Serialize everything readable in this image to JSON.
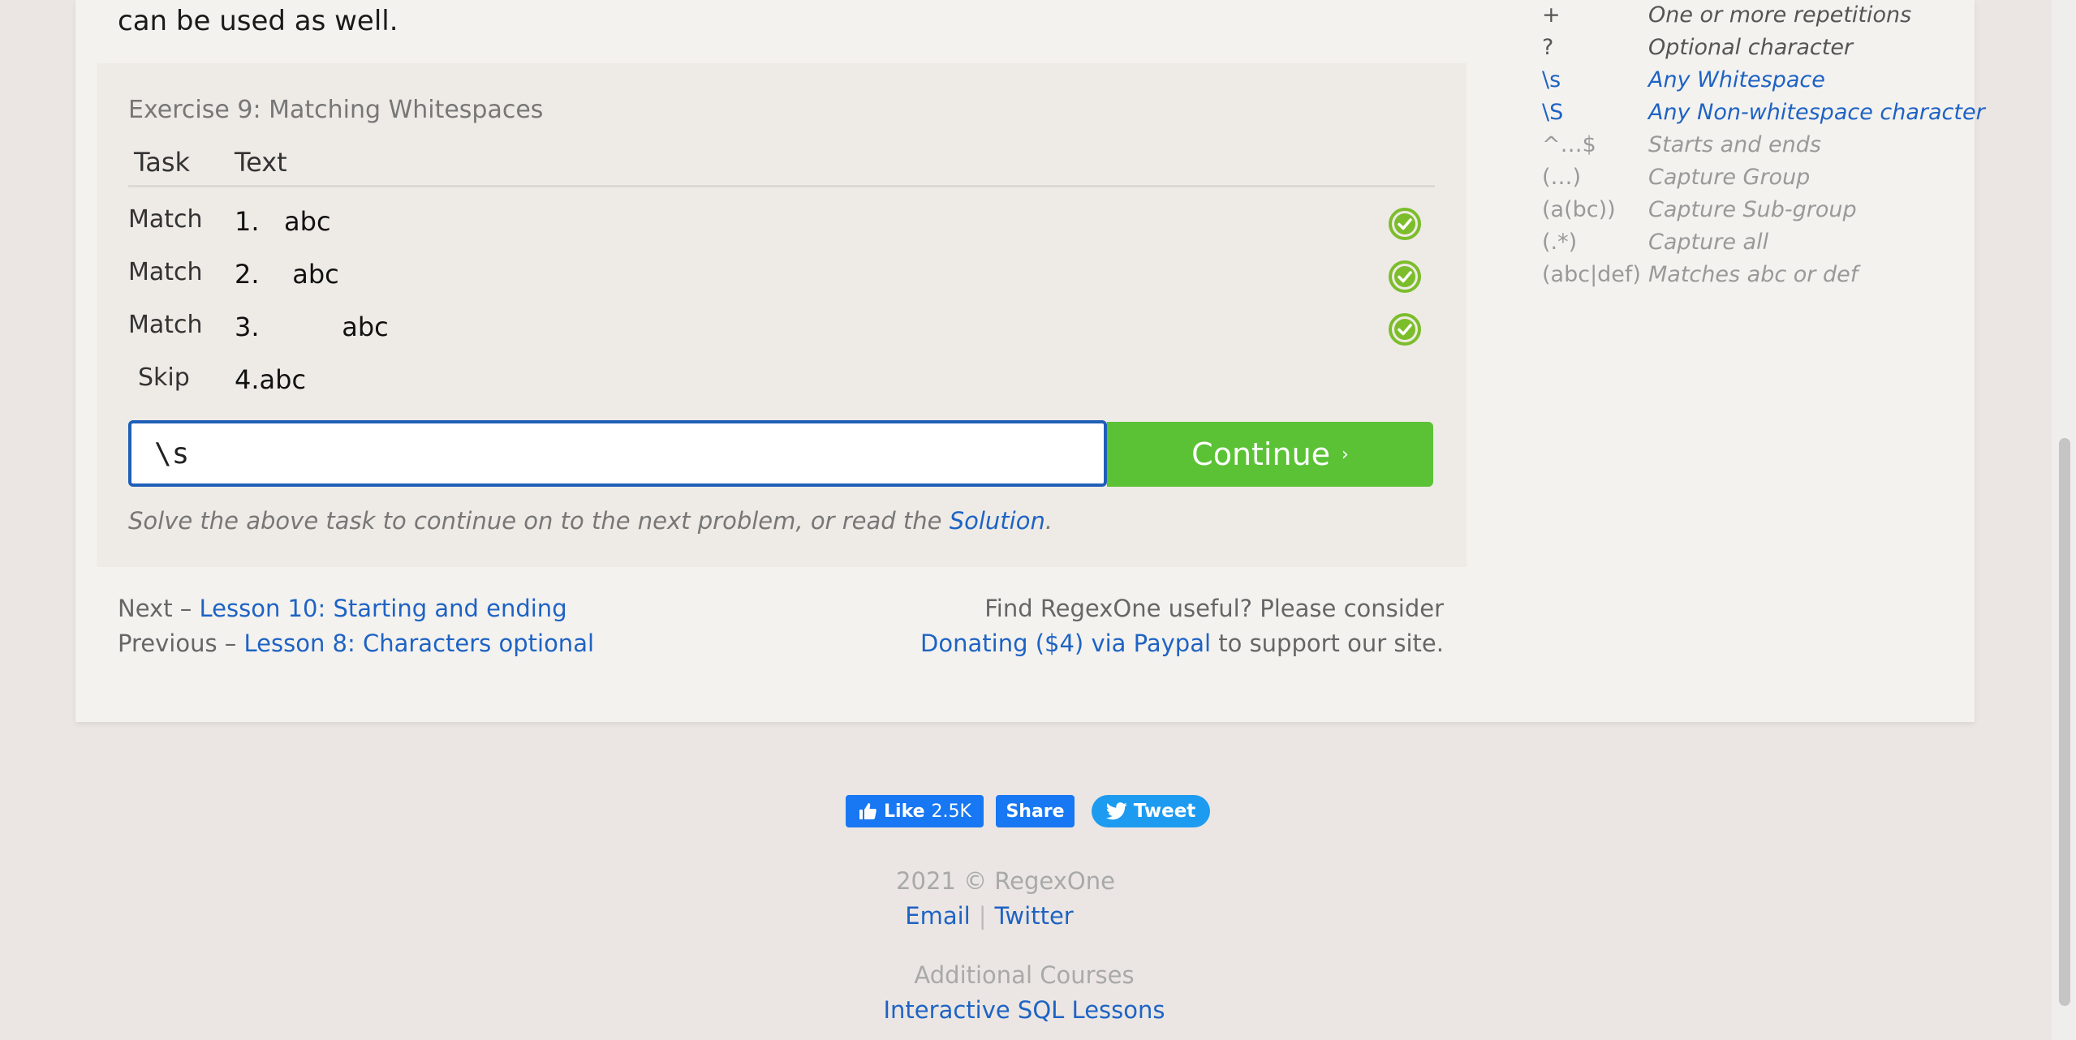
{
  "intro": {
    "text": "can be used as well."
  },
  "exercise": {
    "title": "Exercise 9: Matching Whitespaces",
    "col_task": "Task",
    "col_text": "Text",
    "rows": [
      {
        "task": "Match",
        "text": "1.   abc",
        "status": "check-circle-icon"
      },
      {
        "task": "Match",
        "text": "2.    abc",
        "status": "check-circle-icon"
      },
      {
        "task": "Match",
        "text": "3.          abc",
        "status": "check-circle-icon"
      },
      {
        "task": "Skip",
        "text": "4.abc",
        "status": ""
      }
    ],
    "answer_value": "\\s",
    "continue_label": "Continue",
    "continue_chevron": "›",
    "hint_before": "Solve the above task to continue on to the next problem, or read the ",
    "hint_link": "Solution",
    "hint_after": "."
  },
  "nav": {
    "next_prefix": "Next – ",
    "next_link": "Lesson 10: Starting and ending",
    "prev_prefix": "Previous – ",
    "prev_link": "Lesson 8: Characters optional"
  },
  "donate": {
    "line1": "Find RegexOne useful? Please consider",
    "link": "Donating ($4) via Paypal",
    "after": " to support our site."
  },
  "cheatsheet": [
    {
      "symbol": "+",
      "desc": "One or more repetitions",
      "style": "dark"
    },
    {
      "symbol": "?",
      "desc": "Optional character",
      "style": "dark"
    },
    {
      "symbol": "\\s",
      "desc": "Any Whitespace",
      "style": "blue"
    },
    {
      "symbol": "\\S",
      "desc": "Any Non-whitespace character",
      "style": "blue"
    },
    {
      "symbol": "^…$",
      "desc": "Starts and ends",
      "style": "muted"
    },
    {
      "symbol": "(…)",
      "desc": "Capture Group",
      "style": "muted"
    },
    {
      "symbol": "(a(bc))",
      "desc": "Capture Sub-group",
      "style": "muted"
    },
    {
      "symbol": "(.*)",
      "desc": "Capture all",
      "style": "muted"
    },
    {
      "symbol": "(abc|def)",
      "desc": "Matches abc or def",
      "style": "muted"
    }
  ],
  "social": {
    "like_label": "Like",
    "like_count": "2.5K",
    "share_label": "Share",
    "tweet_label": "Tweet"
  },
  "footer": {
    "copyright": "2021 © RegexOne",
    "email": "Email",
    "separator": "|",
    "twitter": "Twitter",
    "courses_title": "Additional Courses",
    "sql_link": "Interactive SQL Lessons"
  },
  "colors": {
    "accent_blue": "#1e63c4",
    "continue_green": "#5bc236",
    "check_green": "#7cbd2b"
  }
}
